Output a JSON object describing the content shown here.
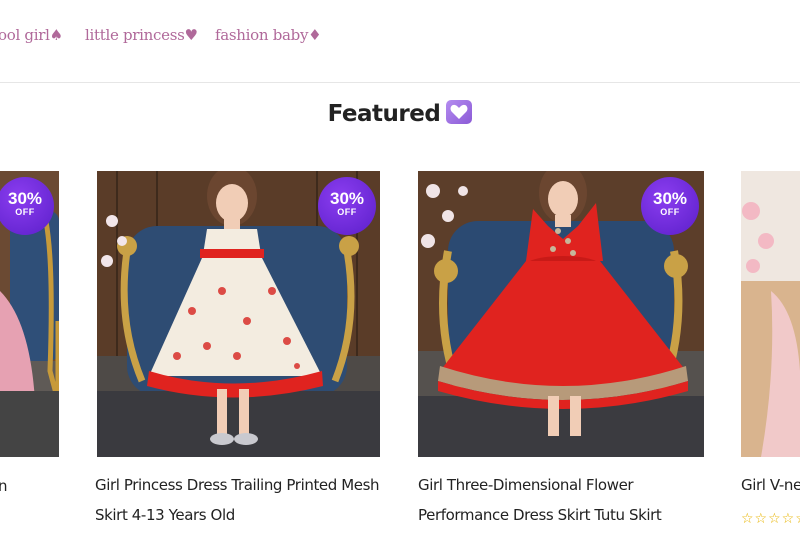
{
  "nav": {
    "links": [
      {
        "label": "ool girl♠"
      },
      {
        "label": "little princess♥"
      },
      {
        "label": "fashion baby♦"
      }
    ]
  },
  "section": {
    "title": "Featured",
    "icon": "heart-icon"
  },
  "products": [
    {
      "title_line1": "n",
      "title_line2": "",
      "discount": "30%",
      "discount_suffix": "OFF",
      "dress_color": "#e6a1b2"
    },
    {
      "title_line1": "Girl Princess Dress Trailing Printed Mesh",
      "title_line2": "Skirt 4-13 Years Old",
      "discount": "30%",
      "discount_suffix": "OFF",
      "dress_color": "#f3ece0"
    },
    {
      "title_line1": "Girl Three-Dimensional Flower",
      "title_line2": "Performance Dress Skirt Tutu Skirt",
      "discount": "30%",
      "discount_suffix": "OFF",
      "dress_color": "#e0231f"
    },
    {
      "title_line1": "Girl V-ne",
      "title_line2": "",
      "rating_stars": "☆☆☆☆☆",
      "dress_color": "#f1c9c9"
    }
  ],
  "colors": {
    "nav_link": "#b0699a",
    "sale_badge": "#6a28dd",
    "heading": "#222222"
  }
}
